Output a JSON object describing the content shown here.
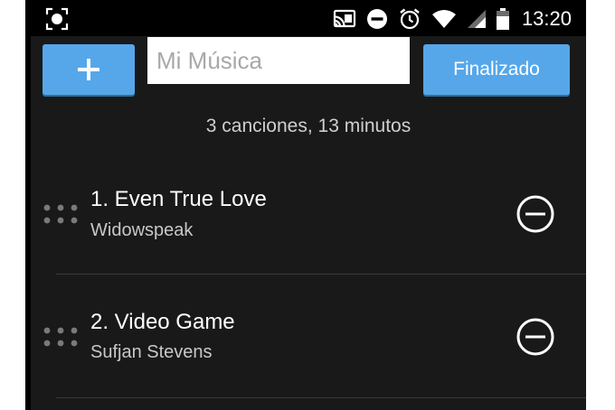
{
  "status_bar": {
    "time": "13:20",
    "icons": [
      "notification-icon",
      "cast-icon",
      "do-not-disturb-icon",
      "alarm-icon",
      "wifi-icon",
      "cell-signal-icon",
      "battery-icon"
    ]
  },
  "toolbar": {
    "add_label": "+",
    "playlist_name_value": "",
    "playlist_name_placeholder": "Mi Música",
    "done_label": "Finalizado"
  },
  "summary": "3 canciones, 13 minutos",
  "tracks": [
    {
      "title": "1. Even True Love",
      "artist": "Widowspeak"
    },
    {
      "title": "2. Video Game",
      "artist": "Sufjan Stevens"
    }
  ],
  "colors": {
    "accent": "#56a7ea",
    "background": "#191919",
    "status_bar": "#000000",
    "divider": "#3a3a3a"
  }
}
